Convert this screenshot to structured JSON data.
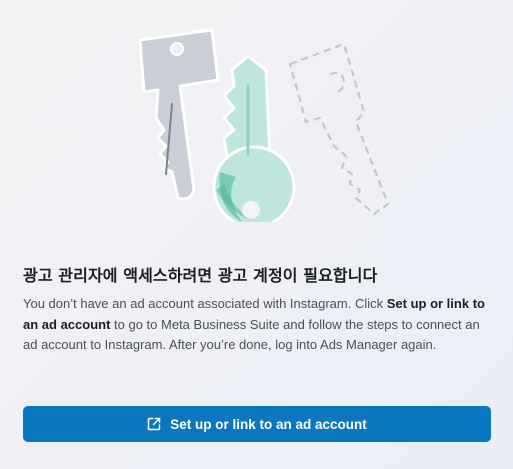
{
  "dialog": {
    "title": "광고 관리자에 액세스하려면 광고 계정이 필요합니다",
    "description": {
      "part1": "You don’t have an ad account associated with Instagram. Click ",
      "bold": "Set up or link to an ad account",
      "part2": " to go to Meta Business Suite and follow the steps to connect an ad account to Instagram. After you’re done, log into Ads Manager again."
    },
    "cta": {
      "label": "Set up or link to an ad account",
      "icon": "external-link-icon"
    }
  },
  "colors": {
    "button": "#0a78be",
    "title": "#1c1e21",
    "body": "#4b4f56",
    "key_gray": "#c8cdd6",
    "key_green": "#bfe6dc",
    "key_teal": "#6fc4b1"
  }
}
